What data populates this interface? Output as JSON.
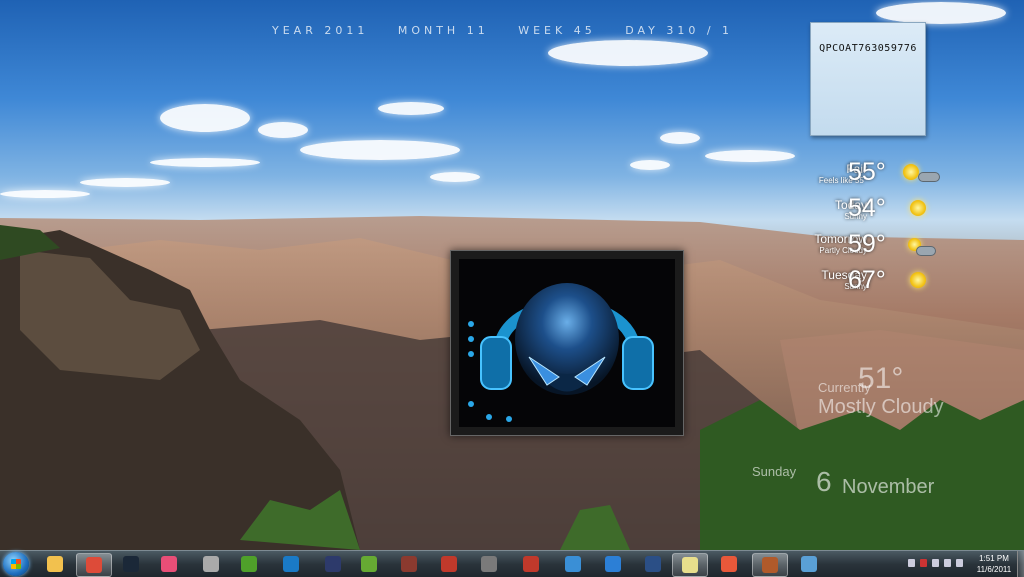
{
  "calendar": {
    "year": "YEAR 2011",
    "month": "MONTH 11",
    "week": "WEEK 45",
    "day": "DAY 310 / 1"
  },
  "sticky_note": {
    "text": "QPCOAT763059776"
  },
  "weather": {
    "current": {
      "label": "Fair",
      "sub": "Feels like 55°",
      "temp": "55°",
      "icon": "sun-cloud-icon"
    },
    "forecast": [
      {
        "label": "Today",
        "sub": "Sunny",
        "temp": "54°",
        "icon": "sun-icon"
      },
      {
        "label": "Tomorrow",
        "sub": "Partly Cloudy",
        "temp": "59°",
        "icon": "sun-cloud-icon"
      },
      {
        "label": "Tuesday",
        "sub": "Sunny",
        "temp": "67°",
        "icon": "sun-icon"
      }
    ]
  },
  "overlay_weather": {
    "label": "Currently",
    "temp": "51°",
    "desc": "Mostly Cloudy"
  },
  "overlay_date": {
    "day": "Sunday",
    "num": "6",
    "month": "November"
  },
  "taskbar": {
    "apps": [
      {
        "name": "file-explorer-icon",
        "color": "#f2c14e"
      },
      {
        "name": "chrome-icon",
        "color": "#dd4b39"
      },
      {
        "name": "steam-icon",
        "color": "#1b2838"
      },
      {
        "name": "picasa-icon",
        "color": "#e94e77"
      },
      {
        "name": "media-center-icon",
        "color": "#aaaaaa"
      },
      {
        "name": "utorrent-icon",
        "color": "#4fa02a"
      },
      {
        "name": "photoshop-icon",
        "color": "#1a7ac6"
      },
      {
        "name": "after-effects-icon",
        "color": "#2d3a6b"
      },
      {
        "name": "hulu-icon",
        "color": "#66aa33"
      },
      {
        "name": "game-icon",
        "color": "#8b3a2f"
      },
      {
        "name": "pdf-icon",
        "color": "#c0392b"
      },
      {
        "name": "controller-icon",
        "color": "#7a7a7a"
      },
      {
        "name": "paint-icon",
        "color": "#c0392b"
      },
      {
        "name": "photo-viewer-icon",
        "color": "#3a8fd6"
      },
      {
        "name": "itunes-icon",
        "color": "#2c7fd6"
      },
      {
        "name": "alien-icon",
        "color": "#2b4f86"
      },
      {
        "name": "notes-icon",
        "color": "#e8df8c"
      },
      {
        "name": "maps-icon",
        "color": "#e8583a"
      },
      {
        "name": "book-icon",
        "color": "#b05a2b"
      },
      {
        "name": "paint-palette-icon",
        "color": "#5aa0d6"
      }
    ],
    "clock_time": "1:51 PM",
    "clock_date": "11/6/2011"
  }
}
